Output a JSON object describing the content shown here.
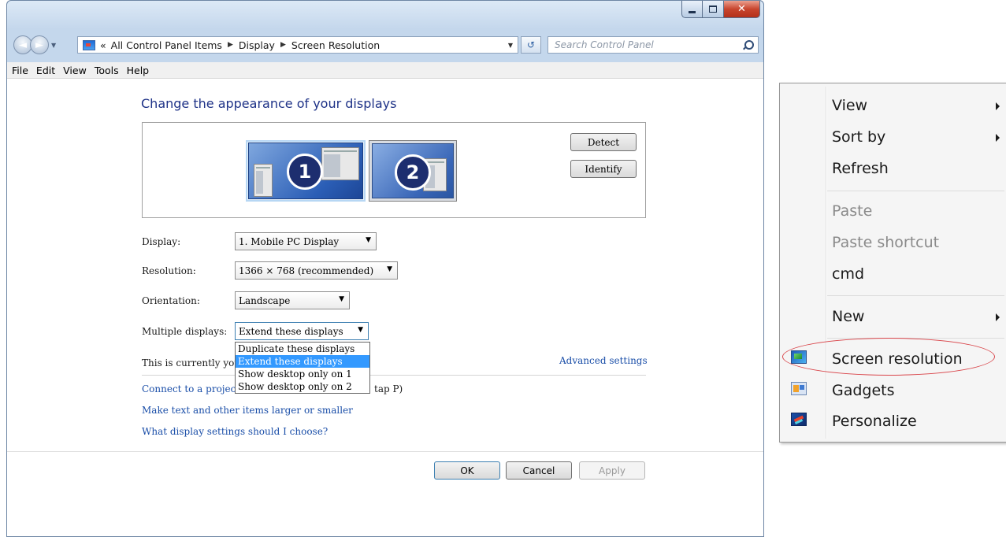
{
  "window": {
    "address": {
      "prefix": "«",
      "crumbs": [
        "All Control Panel Items",
        "Display",
        "Screen Resolution"
      ]
    },
    "search_placeholder": "Search Control Panel",
    "menu": [
      "File",
      "Edit",
      "View",
      "Tools",
      "Help"
    ],
    "page_title": "Change the appearance of your displays",
    "monitors": [
      "1",
      "2"
    ],
    "detect_label": "Detect",
    "identify_label": "Identify",
    "fields": {
      "display": {
        "label": "Display:",
        "value": "1. Mobile PC Display"
      },
      "resolution": {
        "label": "Resolution:",
        "value": "1366 × 768 (recommended)"
      },
      "orientation": {
        "label": "Orientation:",
        "value": "Landscape"
      },
      "multiple": {
        "label": "Multiple displays:",
        "value": "Extend these displays"
      }
    },
    "dropdown_options": [
      "Duplicate these displays",
      "Extend these displays",
      "Show desktop only on 1",
      "Show desktop only on 2"
    ],
    "dropdown_selected_index": 1,
    "main_display_text": "This is currently you",
    "advanced_link": "Advanced settings",
    "links": {
      "projector_start": "Connect to a projec",
      "projector_end": "tap P)",
      "text_size": "Make text and other items larger or smaller",
      "which_settings": "What display settings should I choose?"
    },
    "buttons": {
      "ok": "OK",
      "cancel": "Cancel",
      "apply": "Apply"
    }
  },
  "context_menu": {
    "items": [
      {
        "label": "View",
        "submenu": true,
        "enabled": true
      },
      {
        "label": "Sort by",
        "submenu": true,
        "enabled": true
      },
      {
        "label": "Refresh",
        "submenu": false,
        "enabled": true
      },
      {
        "label": "Paste",
        "submenu": false,
        "enabled": false
      },
      {
        "label": "Paste shortcut",
        "submenu": false,
        "enabled": false
      },
      {
        "label": "cmd",
        "submenu": false,
        "enabled": true
      },
      {
        "label": "New",
        "submenu": true,
        "enabled": true
      },
      {
        "label": "Screen resolution",
        "submenu": false,
        "enabled": true,
        "icon": "screen-resolution-icon"
      },
      {
        "label": "Gadgets",
        "submenu": false,
        "enabled": true,
        "icon": "gadgets-icon"
      },
      {
        "label": "Personalize",
        "submenu": false,
        "enabled": true,
        "icon": "personalize-icon"
      }
    ],
    "highlight_color": "#d9454a"
  }
}
